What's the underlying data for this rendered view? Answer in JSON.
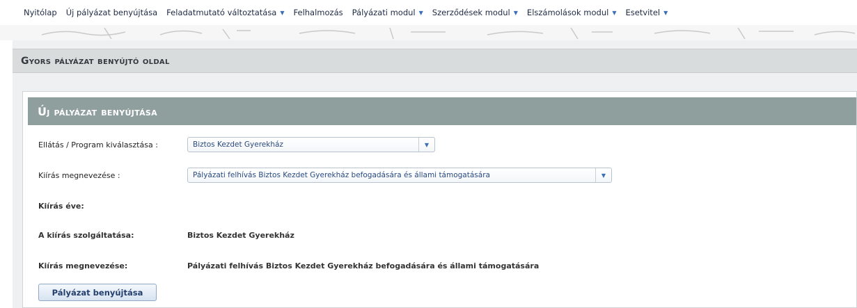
{
  "nav": {
    "items": [
      {
        "label": "Nyitólap",
        "dropdown": false
      },
      {
        "label": "Új pályázat benyújtása",
        "dropdown": false
      },
      {
        "label": "Feladatmutató változtatása",
        "dropdown": true
      },
      {
        "label": "Felhalmozás",
        "dropdown": false
      },
      {
        "label": "Pályázati modul",
        "dropdown": true
      },
      {
        "label": "Szerződések modul",
        "dropdown": true
      },
      {
        "label": "Elszámolások modul",
        "dropdown": true
      },
      {
        "label": "Esetvitel",
        "dropdown": true
      }
    ],
    "caret": "▼"
  },
  "page": {
    "title": "Gyors pályázat benyújtó oldal"
  },
  "panel": {
    "title": "Új pályázat benyújtása",
    "program_label": "Ellátás / Program kiválasztása :",
    "program_value": "Biztos Kezdet Gyerekház",
    "kiiras_label": "Kiírás megnevezése :",
    "kiiras_value": "Pályázati felhívás Biztos Kezdet Gyerekház befogadására és állami támogatására",
    "ev_label": "Kiírás éve:",
    "szolgaltatas_label": "A kiírás szolgáltatása:",
    "szolgaltatas_value": "Biztos Kezdet Gyerekház",
    "megnevezes_label": "Kiírás megnevezése:",
    "megnevezes_value": "Pályázati felhívás Biztos Kezdet Gyerekház befogadására és állami támogatására",
    "submit_label": "Pályázat benyújtása"
  },
  "colors": {
    "panel_header": "#8f9f9d",
    "page_header": "#d8dcdd",
    "link_blue": "#2a4a7f"
  },
  "icons": {
    "dropdown": "chevron-down-icon"
  }
}
